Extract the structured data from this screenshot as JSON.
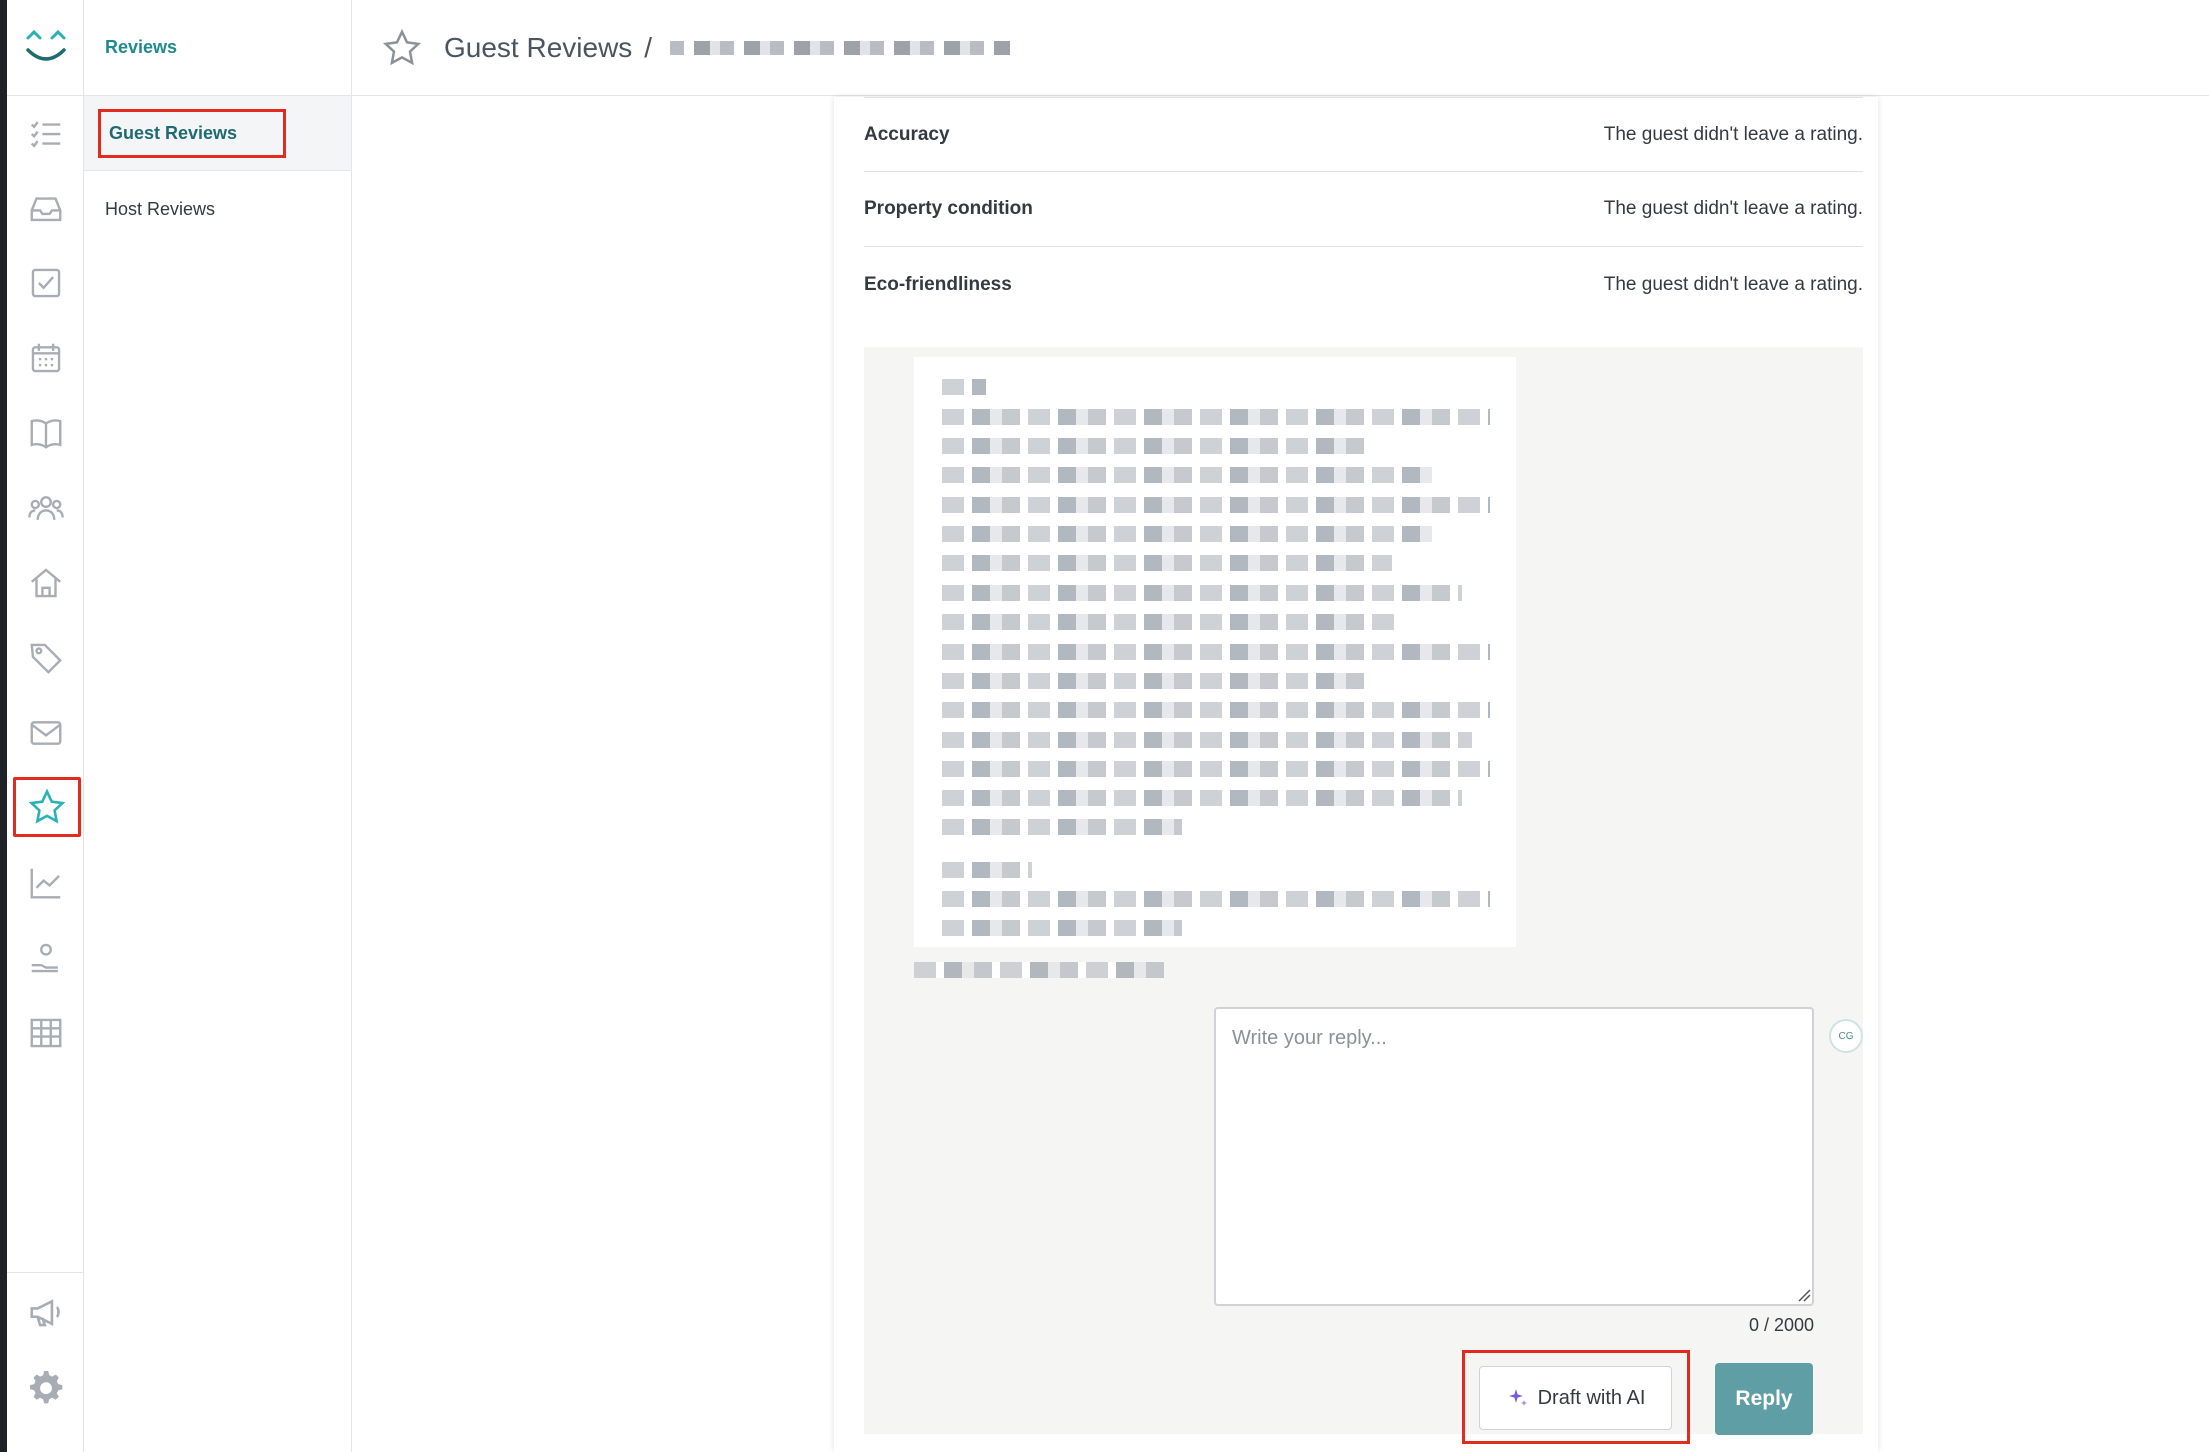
{
  "app": {
    "section_title": "Reviews",
    "accent_color": "#1f8a8f",
    "highlight_color": "#e32a1f"
  },
  "rail": {
    "icons": [
      "smile-logo-icon",
      "list-icon",
      "inbox-icon",
      "checkbox-icon",
      "calendar-icon",
      "book-icon",
      "guests-icon",
      "home-icon",
      "tag-icon",
      "mail-icon",
      "star-icon",
      "chart-icon",
      "hand-icon",
      "grid-icon",
      "megaphone-icon",
      "gear-icon"
    ],
    "active": "star-icon"
  },
  "subnav": {
    "items": [
      {
        "label": "Guest Reviews",
        "active": true
      },
      {
        "label": "Host Reviews",
        "active": false
      }
    ]
  },
  "header": {
    "title": "Guest Reviews",
    "separator": "/"
  },
  "ratings": [
    {
      "label": "Accuracy",
      "value": "The guest didn't leave a rating."
    },
    {
      "label": "Property condition",
      "value": "The guest didn't leave a rating."
    },
    {
      "label": "Eco-friendliness",
      "value": "The guest didn't leave a rating."
    }
  ],
  "reply": {
    "placeholder": "Write your reply...",
    "value": "",
    "counter": "0  / 2000",
    "avatar_initials": "CG",
    "draft_label": "Draft with AI",
    "reply_label": "Reply"
  }
}
